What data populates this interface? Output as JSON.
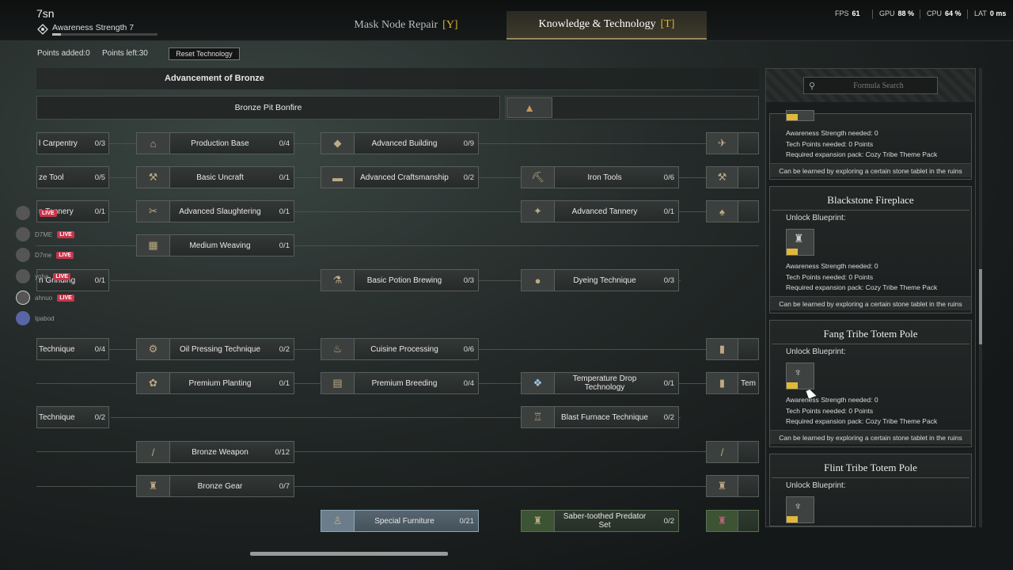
{
  "header": {
    "player_name": "7sn",
    "awareness_label": "Awareness Strength 7",
    "awareness_progress": 0.08,
    "tabs": [
      {
        "label": "Mask Node Repair",
        "key": "[Y]",
        "active": false
      },
      {
        "label": "Knowledge & Technology",
        "key": "[T]",
        "active": true
      }
    ],
    "stats": {
      "fps_label": "FPS",
      "fps": "61",
      "gpu_label": "GPU",
      "gpu": "88 %",
      "cpu_label": "CPU",
      "cpu": "64 %",
      "lat_label": "LAT",
      "lat": "0 ms"
    }
  },
  "points": {
    "added": "Points added:0",
    "left": "Points left:30",
    "reset_label": "Reset Technology"
  },
  "tree": {
    "section_title": "Advancement of Bronze",
    "bonfire": "Bronze Pit Bonfire",
    "left_partial": [
      {
        "name": "l Carpentry",
        "count": "0/3"
      },
      {
        "name": "ze Tool",
        "count": "0/5"
      },
      {
        "name": "n Tannery",
        "count": "0/1"
      },
      {
        "name": "n Grinding",
        "count": "0/1"
      },
      {
        "name": "Technique",
        "count": "0/4"
      },
      {
        "name": "Technique",
        "count": "0/2"
      }
    ],
    "col1": [
      {
        "name": "Production Base",
        "count": "0/4",
        "icon": "house-icon"
      },
      {
        "name": "Basic Uncraft",
        "count": "0/1",
        "icon": "hammer-icon"
      },
      {
        "name": "Advanced Slaughtering",
        "count": "0/1",
        "icon": "knife-icon"
      },
      {
        "name": "Medium Weaving",
        "count": "0/1",
        "icon": "loom-icon"
      },
      {
        "name": "Oil Pressing Technique",
        "count": "0/2",
        "icon": "press-icon"
      },
      {
        "name": "Premium Planting",
        "count": "0/1",
        "icon": "plant-icon"
      },
      {
        "name": "Bronze Weapon",
        "count": "0/12",
        "icon": "spear-icon"
      },
      {
        "name": "Bronze Gear",
        "count": "0/7",
        "icon": "armor-icon"
      }
    ],
    "col2": [
      {
        "name": "Advanced Building",
        "count": "0/9",
        "icon": "cube-icon"
      },
      {
        "name": "Advanced Craftsmanship",
        "count": "0/2",
        "icon": "workbench-icon"
      },
      {
        "name": "Basic Potion Brewing",
        "count": "0/3",
        "icon": "potion-icon"
      },
      {
        "name": "Cuisine Processing",
        "count": "0/6",
        "icon": "pot-icon"
      },
      {
        "name": "Premium Breeding",
        "count": "0/4",
        "icon": "pen-icon"
      },
      {
        "name": "Special Furniture",
        "count": "0/21",
        "icon": "statue-icon"
      }
    ],
    "col3": [
      {
        "name": "Iron Tools",
        "count": "0/6",
        "icon": "pickaxe-icon"
      },
      {
        "name": "Advanced Tannery",
        "count": "0/1",
        "icon": "hide-icon"
      },
      {
        "name": "Dyeing Technique",
        "count": "0/3",
        "icon": "dye-icon"
      },
      {
        "name": "Temperature Drop Technology",
        "count": "0/1",
        "icon": "crystal-icon"
      },
      {
        "name": "Blast Furnace Technique",
        "count": "0/2",
        "icon": "furnace-icon"
      },
      {
        "name": "Saber-toothed Predator Set",
        "count": "0/2",
        "icon": "armor-icon"
      }
    ],
    "right_partial": [
      {
        "name": "",
        "icon": "cart-icon"
      },
      {
        "name": "",
        "icon": "hammer-icon"
      },
      {
        "name": "",
        "icon": "sack-icon"
      },
      {
        "name": "",
        "icon": "pillar-icon"
      },
      {
        "name": "Tem",
        "icon": "pillar-icon"
      },
      {
        "name": "",
        "icon": "spear-icon"
      },
      {
        "name": "",
        "icon": "armor-icon"
      },
      {
        "name": "",
        "icon": "armor-icon"
      }
    ]
  },
  "social": [
    {
      "name": "",
      "live": "LIVE"
    },
    {
      "name": "D7ME",
      "live": "LIVE"
    },
    {
      "name": "D7me",
      "live": "LIVE"
    },
    {
      "name": "yoha",
      "live": "LIVE"
    },
    {
      "name": "ahnuo",
      "live": "LIVE"
    },
    {
      "name": "Ipabod",
      "live": ""
    }
  ],
  "panel": {
    "search_placeholder": "Formula Search",
    "partial_card": {
      "req": [
        "Awareness Strength needed: 0",
        "Tech Points needed: 0 Points",
        "Required expansion pack: Cozy Tribe Theme Pack"
      ],
      "foot": "Can be learned by exploring a certain stone tablet in the ruins"
    },
    "cards": [
      {
        "title": "Blackstone Fireplace",
        "unlock": "Unlock Blueprint:",
        "req": [
          "Awareness Strength needed: 0",
          "Tech Points needed: 0 Points",
          "Required expansion pack: Cozy Tribe Theme Pack"
        ],
        "foot": "Can be learned by exploring a certain stone tablet in the ruins"
      },
      {
        "title": "Fang Tribe Totem Pole",
        "unlock": "Unlock Blueprint:",
        "req": [
          "Awareness Strength needed: 0",
          "Tech Points needed: 0 Points",
          "Required expansion pack: Cozy Tribe Theme Pack"
        ],
        "foot": "Can be learned by exploring a certain stone tablet in the ruins"
      },
      {
        "title": "Flint Tribe Totem Pole",
        "unlock": "Unlock Blueprint:"
      }
    ]
  },
  "colors": {
    "accent_gold": "#e3b533",
    "live_red": "#c9344a",
    "special_blue": "#56656f"
  }
}
